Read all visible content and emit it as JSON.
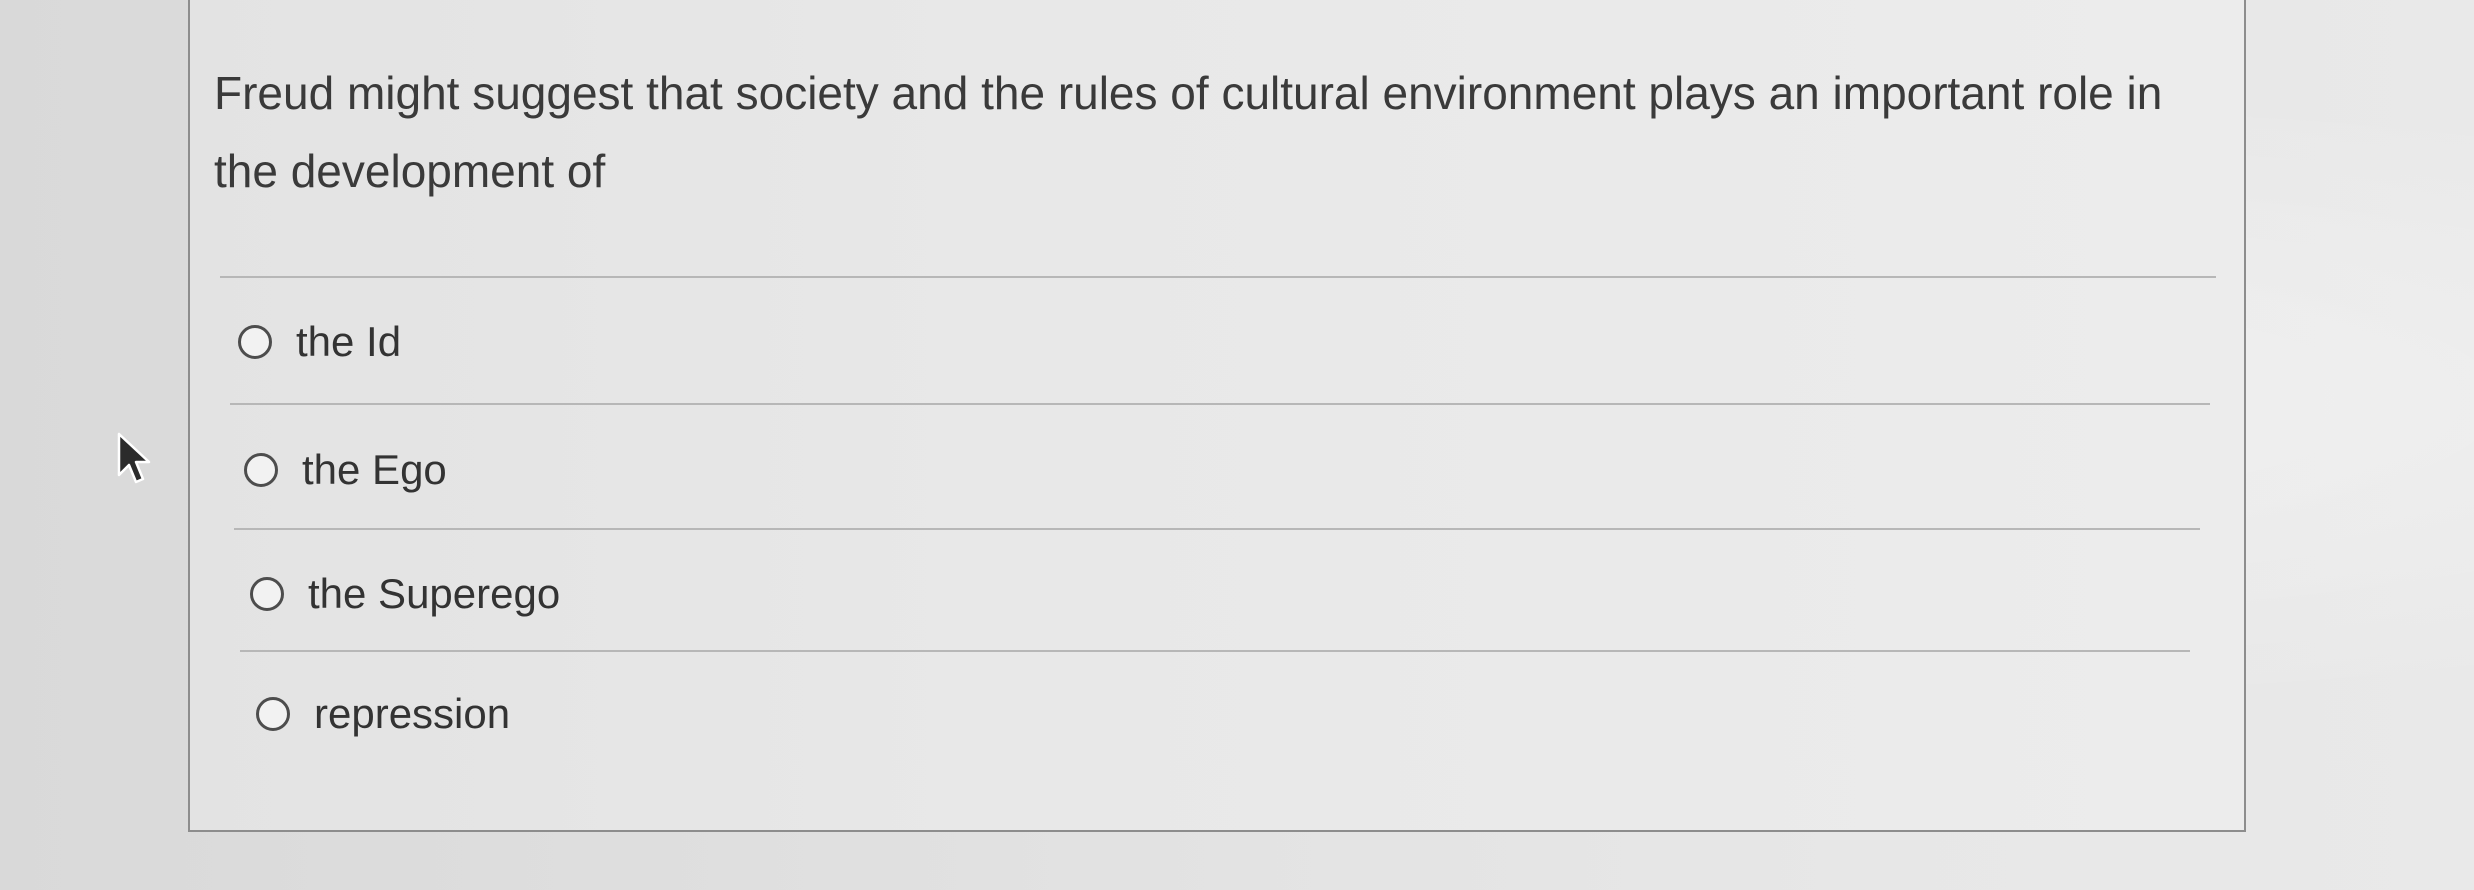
{
  "question": {
    "text": "Freud might suggest that society and the rules of cultural environment plays an important role in the development of"
  },
  "options": [
    {
      "label": "the Id",
      "selected": false
    },
    {
      "label": "the Ego",
      "selected": false
    },
    {
      "label": "the Superego",
      "selected": false
    },
    {
      "label": "repression",
      "selected": false
    }
  ],
  "icons": {
    "radio": "radio-button-unchecked-icon",
    "pointer": "mouse-pointer-icon"
  }
}
